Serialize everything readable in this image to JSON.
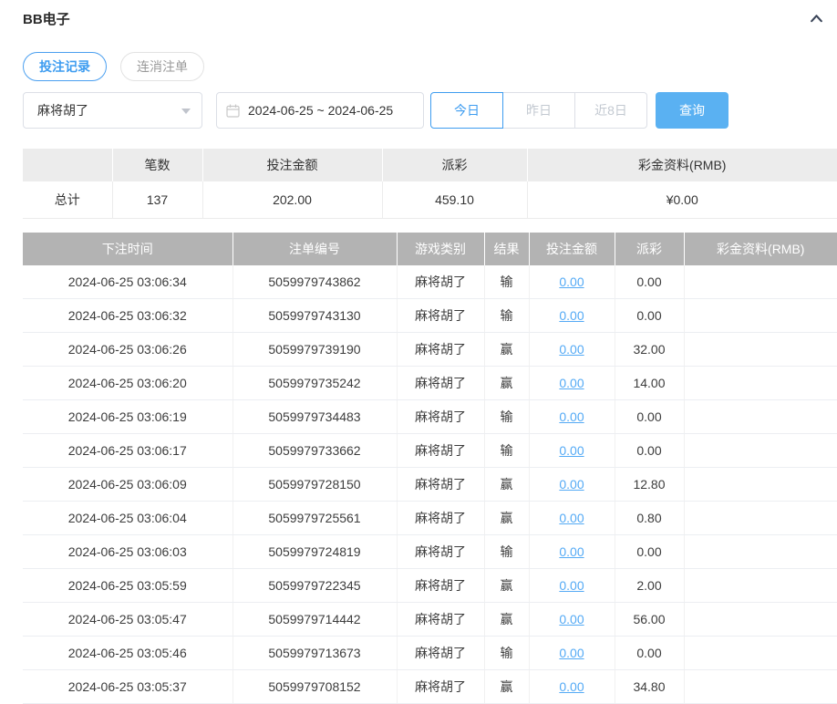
{
  "panel": {
    "title": "BB电子"
  },
  "tabs": [
    {
      "label": "投注记录",
      "active": true
    },
    {
      "label": "连消注单",
      "active": false
    }
  ],
  "filters": {
    "game_select": {
      "value": "麻将胡了"
    },
    "date_range": {
      "value": "2024-06-25 ~ 2024-06-25"
    },
    "quick_buttons": [
      {
        "label": "今日",
        "active": true
      },
      {
        "label": "昨日",
        "active": false
      },
      {
        "label": "近8日",
        "active": false
      }
    ],
    "search_label": "查询"
  },
  "summary": {
    "headers": [
      "",
      "笔数",
      "投注金额",
      "派彩",
      "彩金资料(RMB)"
    ],
    "total_row": [
      "总计",
      "137",
      "202.00",
      "459.10",
      "¥0.00"
    ]
  },
  "table": {
    "headers": [
      "下注时间",
      "注单编号",
      "游戏类别",
      "结果",
      "投注金额",
      "派彩",
      "彩金资料(RMB)"
    ],
    "rows": [
      [
        "2024-06-25 03:06:34",
        "5059979743862",
        "麻将胡了",
        "输",
        "0.00",
        "0.00",
        ""
      ],
      [
        "2024-06-25 03:06:32",
        "5059979743130",
        "麻将胡了",
        "输",
        "0.00",
        "0.00",
        ""
      ],
      [
        "2024-06-25 03:06:26",
        "5059979739190",
        "麻将胡了",
        "赢",
        "0.00",
        "32.00",
        ""
      ],
      [
        "2024-06-25 03:06:20",
        "5059979735242",
        "麻将胡了",
        "赢",
        "0.00",
        "14.00",
        ""
      ],
      [
        "2024-06-25 03:06:19",
        "5059979734483",
        "麻将胡了",
        "输",
        "0.00",
        "0.00",
        ""
      ],
      [
        "2024-06-25 03:06:17",
        "5059979733662",
        "麻将胡了",
        "输",
        "0.00",
        "0.00",
        ""
      ],
      [
        "2024-06-25 03:06:09",
        "5059979728150",
        "麻将胡了",
        "赢",
        "0.00",
        "12.80",
        ""
      ],
      [
        "2024-06-25 03:06:04",
        "5059979725561",
        "麻将胡了",
        "赢",
        "0.00",
        "0.80",
        ""
      ],
      [
        "2024-06-25 03:06:03",
        "5059979724819",
        "麻将胡了",
        "输",
        "0.00",
        "0.00",
        ""
      ],
      [
        "2024-06-25 03:05:59",
        "5059979722345",
        "麻将胡了",
        "赢",
        "0.00",
        "2.00",
        ""
      ],
      [
        "2024-06-25 03:05:47",
        "5059979714442",
        "麻将胡了",
        "赢",
        "0.00",
        "56.00",
        ""
      ],
      [
        "2024-06-25 03:05:46",
        "5059979713673",
        "麻将胡了",
        "输",
        "0.00",
        "0.00",
        ""
      ],
      [
        "2024-06-25 03:05:37",
        "5059979708152",
        "麻将胡了",
        "赢",
        "0.00",
        "34.80",
        ""
      ]
    ]
  },
  "colors": {
    "accent": "#3d9cf0",
    "search_button": "#5ab1f2",
    "link": "#54aaf5",
    "table_header_bg": "#b3b3b3",
    "summary_header_bg": "#ececec",
    "inactive_text": "#c3c9d1"
  }
}
